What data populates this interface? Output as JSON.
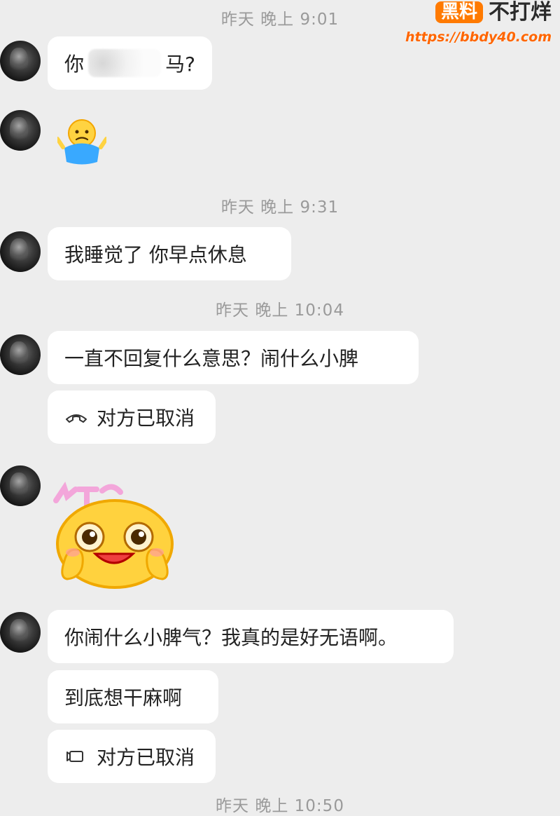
{
  "watermark": {
    "brand_main": "黑料",
    "brand_side": "不打烊",
    "url": "https://bbdy40.com"
  },
  "timestamps": [
    "昨天 晚上 9:01",
    "昨天 晚上 9:31",
    "昨天 晚上 10:04",
    "昨天 晚上 10:50"
  ],
  "messages": [
    {
      "text_left": "你",
      "text_right": "马?"
    },
    {
      "emoji": "🤷"
    },
    {
      "text": "我睡觉了 你早点休息"
    },
    {
      "text": "一直不回复什么意思？闹什么小脾"
    },
    {
      "call": "对方已取消"
    },
    {
      "sticker": "sticker"
    },
    {
      "text": "你闹什么小脾气？我真的是好无语啊。"
    },
    {
      "text": "到底想干麻啊"
    },
    {
      "call": "对方已取消"
    }
  ]
}
